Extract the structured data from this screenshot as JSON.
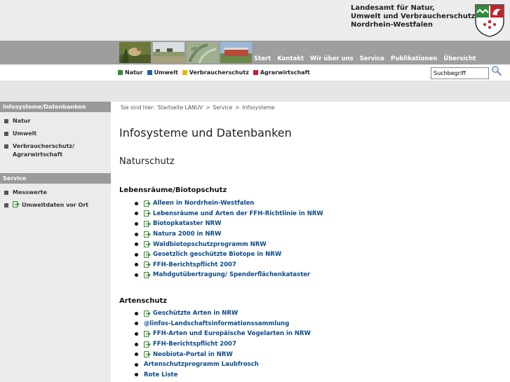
{
  "header": {
    "agency_lines": [
      "Landesamt für Natur,",
      "Umwelt und Verbraucherschutz",
      "Nordrhein-Westfalen"
    ],
    "crest_icon": "nrw-coat-of-arms-icon"
  },
  "main_nav": [
    "Start",
    "Kontakt",
    "Wir über uns",
    "Service",
    "Publikationen",
    "Übersicht"
  ],
  "themes": [
    {
      "label": "Natur",
      "color": "#2e8b2e"
    },
    {
      "label": "Umwelt",
      "color": "#1f5fa8"
    },
    {
      "label": "Verbraucherschutz",
      "color": "#e6b800"
    },
    {
      "label": "Agrarwirtschaft",
      "color": "#c8202a"
    }
  ],
  "search": {
    "value": "Suchbegriff",
    "icon": "magnifier-icon"
  },
  "sidebar": {
    "sections": [
      {
        "title": "Infosysteme/Datenbanken",
        "items": [
          {
            "label": "Natur",
            "external": false
          },
          {
            "label": "Umwelt",
            "external": false
          },
          {
            "label": "Verbraucherschutz/ Agrarwirtschaft",
            "external": false
          }
        ]
      },
      {
        "title": "Service",
        "items": [
          {
            "label": "Messwerte",
            "external": false
          },
          {
            "label": "Umweltdaten vor Ort",
            "external": true
          }
        ]
      }
    ]
  },
  "breadcrumb": {
    "prefix": "Sie sind hier:",
    "items": [
      "Startseite LANUV",
      "Service",
      "Infosysteme"
    ],
    "separator": ">"
  },
  "content": {
    "title": "Infosysteme und Datenbanken",
    "subtitle": "Naturschutz",
    "sections": [
      {
        "heading": "Lebensräume/Biotopschutz",
        "links": [
          {
            "label": "Alleen in Nordrhein-Westfalen",
            "external": true
          },
          {
            "label": "Lebensräume und Arten der FFH-Richtlinie in NRW",
            "external": true
          },
          {
            "label": "Biotopkataster NRW",
            "external": true
          },
          {
            "label": "Natura 2000 in NRW",
            "external": true
          },
          {
            "label": "Waldbiotopschutzprogramm NRW",
            "external": true
          },
          {
            "label": "Gesetzlich geschützte Biotope in NRW",
            "external": true
          },
          {
            "label": "FFH-Berichtspflicht 2007",
            "external": true
          },
          {
            "label": "Mahdgutübertragung/ Spenderflächenkataster",
            "external": true
          }
        ]
      },
      {
        "heading": "Artenschutz",
        "links": [
          {
            "label": "Geschützte Arten in NRW",
            "external": true
          },
          {
            "label": "@linfos-Landschaftsinformationssammlung",
            "external": false
          },
          {
            "label": "FFH-Arten und Europäische Vogelarten in NRW",
            "external": true
          },
          {
            "label": "FFH-Berichtspflicht 2007",
            "external": true
          },
          {
            "label": "Neobiota-Portal in NRW",
            "external": true
          },
          {
            "label": "Artenschutzprogramm Laubfrosch",
            "external": false
          },
          {
            "label": "Rote Liste",
            "external": false
          }
        ]
      }
    ]
  },
  "colors": {
    "link": "#0c4a8a",
    "nav_band": "#9e9e9e",
    "sidebar_bg": "#ebebeb",
    "sidebar_head": "#9a9a9a",
    "ext_icon": "#2e8b2e"
  }
}
